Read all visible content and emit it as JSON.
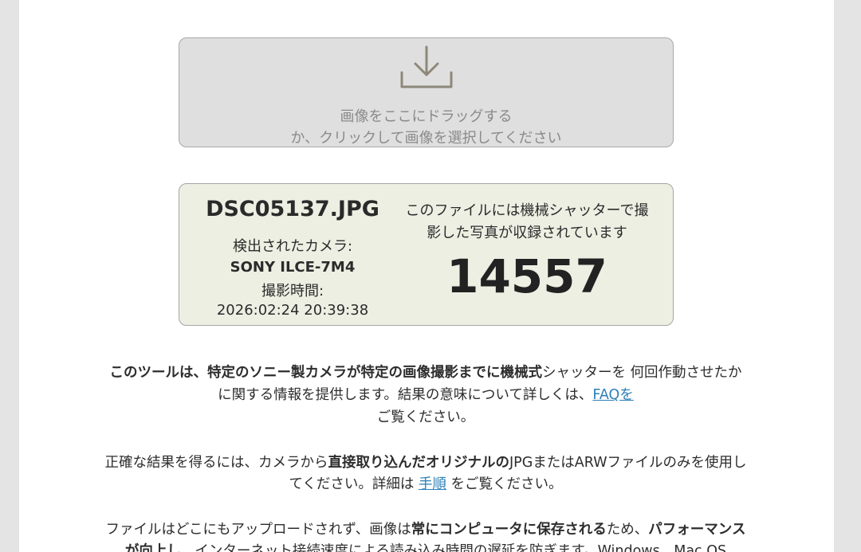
{
  "dropzone": {
    "icon": "download-tray-icon",
    "line1": "画像をここにドラッグする",
    "line2": "か、クリックして画像を選択してください"
  },
  "result": {
    "file_name": "DSC05137.JPG",
    "camera_label": "検出されたカメラ:",
    "camera_model": "SONY ILCE-7M4",
    "shoot_label": "撮影時間:",
    "shoot_time": "2026:02:24 20:39:38",
    "mech_line1": "このファイルには機械シャッターで撮",
    "mech_line2": "影した写真が収録されています",
    "shutter_count": "14557"
  },
  "description": {
    "p1": {
      "l1_b1": "このツールは、特定のソニー製カメラが特定の画像撮影までに機械式",
      "l1_t1": "シャッターを 何回作動させたか",
      "l2_t1": "に関する情報を提供します。結果の意味について詳しくは、",
      "l2_link": "FAQを",
      "l3_t1": "ご覧ください。"
    },
    "p2": {
      "l1_t1": "正確な結果を得るには、カメラから",
      "l1_b1": "直接取り込んだオリジナルの",
      "l1_t2": "JPGまたはARWファイルのみを使用し",
      "l2_t1": "てください。詳細は ",
      "l2_link": "手順",
      "l2_t2": " をご覧ください。"
    },
    "p3": {
      "l1_t1": "ファイルはどこにもアップロードされず、画像は",
      "l1_b1": "常にコンピュータに保存される",
      "l1_t2": "ため、",
      "l1_b2": "パフォーマンス",
      "l2_b1": "が向上し",
      "l2_t1": "、インターネット接続速度による読み込み時間の遅延を防ぎます。Windows、Mac OS"
    }
  },
  "colors": {
    "background": "#e4e4e4",
    "page": "#ffffff",
    "dropzone_bg": "#dfdfdf",
    "card_bg": "#eeefe3",
    "link": "#2a7fb8",
    "icon": "#8d8878"
  }
}
